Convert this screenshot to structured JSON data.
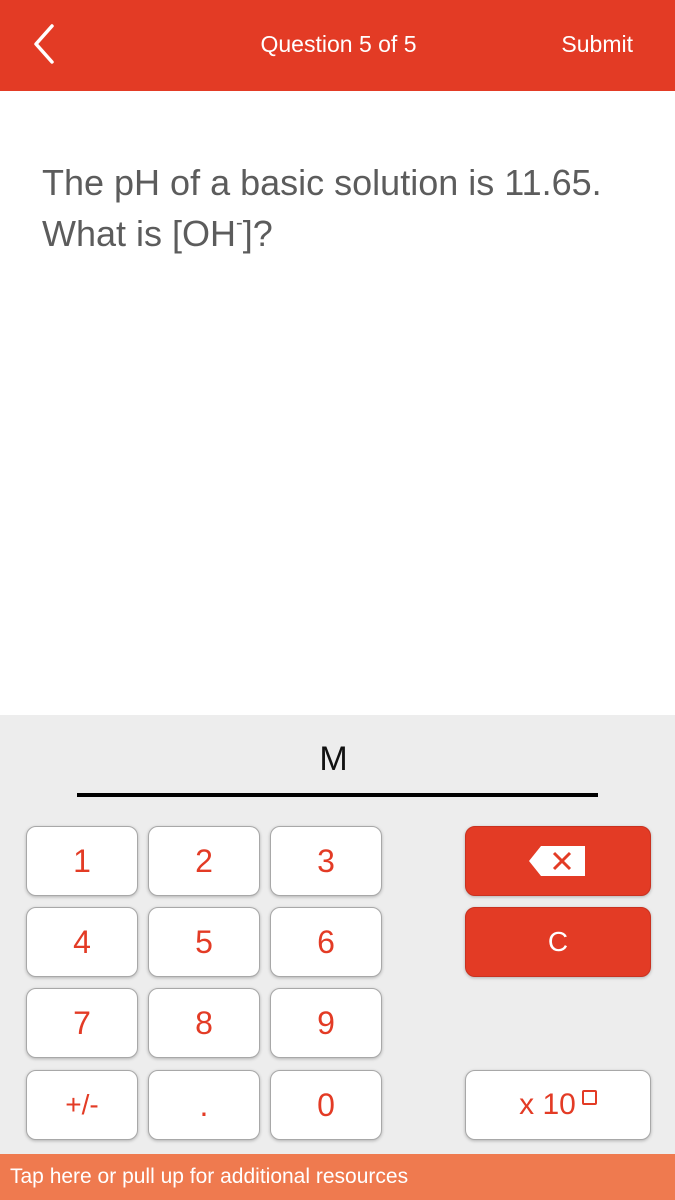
{
  "header": {
    "back_icon": "chevron-left-icon",
    "title": "Question 5 of 5",
    "submit_label": "Submit"
  },
  "question": {
    "line1": "The pH of a basic solution is 11.65.",
    "line2_prefix": "What is [OH",
    "line2_sup": "-",
    "line2_suffix": "]?"
  },
  "answer": {
    "value": "",
    "unit": "M"
  },
  "keypad": {
    "keys": {
      "k1": "1",
      "k2": "2",
      "k3": "3",
      "k4": "4",
      "k5": "5",
      "k6": "6",
      "k7": "7",
      "k8": "8",
      "k9": "9",
      "plus_minus": "+/-",
      "decimal": ".",
      "k0": "0"
    },
    "backspace_icon": "backspace-icon",
    "clear_label": "C",
    "exponent_label": "x 10",
    "colors": {
      "accent": "#e33b25",
      "footer": "#ef7a4f"
    }
  },
  "footer": {
    "label": "Tap here or pull up for additional resources"
  }
}
